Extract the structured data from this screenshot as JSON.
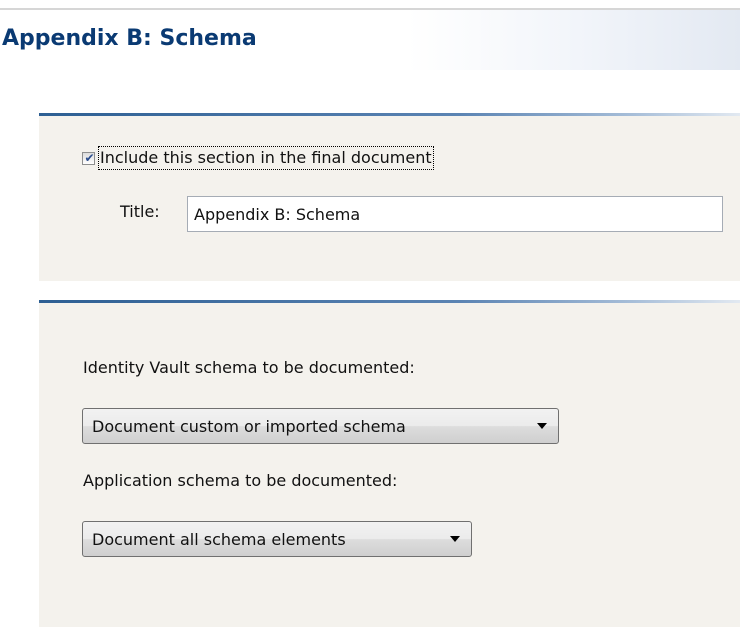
{
  "header": {
    "title": "Appendix B: Schema"
  },
  "include_section": {
    "checked": true,
    "label": "Include this section in the final document"
  },
  "title_field": {
    "label": "Title:",
    "value": "Appendix B: Schema"
  },
  "identity_vault": {
    "label": "Identity Vault schema to be documented:",
    "selected": "Document custom or imported schema"
  },
  "application_schema": {
    "label": "Application schema to be documented:",
    "selected": "Document all schema elements"
  },
  "colors": {
    "title_blue": "#0a3a73",
    "section_background": "#f4f2ed",
    "rule_blue": "#2d5f93"
  },
  "icons": {
    "checkbox_mark": "checkmark-icon",
    "dropdown_arrow": "chevron-down-icon"
  }
}
